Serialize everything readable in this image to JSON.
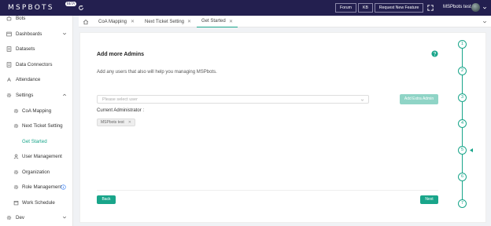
{
  "header": {
    "logo": "MSPBOTS",
    "beta": "BETA",
    "links": [
      "Forum",
      "KB",
      "Request New Feature"
    ],
    "user_name": "MSPbots test"
  },
  "sidebar": {
    "items": [
      {
        "label": "Bots",
        "icon": "bot-icon",
        "top": 0
      },
      {
        "label": "Dashboards",
        "icon": "dashboard-icon",
        "arrow": "down"
      },
      {
        "label": "Datasets",
        "icon": "dataset-icon"
      },
      {
        "label": "Data Connectors",
        "icon": "connector-icon"
      },
      {
        "label": "Attendance",
        "icon": "attendance-icon"
      },
      {
        "label": "Settings",
        "icon": "gear-icon",
        "arrow": "up"
      },
      {
        "label": "CoA Mapping",
        "icon": "gear-icon",
        "sub": true
      },
      {
        "label": "Next Ticket Setting",
        "icon": "gear-icon",
        "sub": true
      },
      {
        "label": "Get Started",
        "sub": true,
        "active": true
      },
      {
        "label": "User Management",
        "icon": "user-icon",
        "sub": true
      },
      {
        "label": "Organization",
        "icon": "gear-icon",
        "sub": true
      },
      {
        "label": "Role Management",
        "icon": "gear-icon",
        "sub": true,
        "info": true
      },
      {
        "label": "Work Schedule",
        "icon": "calendar-icon",
        "sub": true
      },
      {
        "label": "Dev",
        "icon": "gear-icon",
        "arrow": "down"
      }
    ]
  },
  "tabs": [
    {
      "label": "CoA Mapping"
    },
    {
      "label": "Next Ticket Setting"
    },
    {
      "label": "Get Started",
      "active": true
    }
  ],
  "main": {
    "title": "Add more Admins",
    "description": "Add any users that also will help you managing MSPbots.",
    "select_placeholder": "Please select user",
    "add_button": "Add Extra Admin",
    "current_label": "Current Administrator :",
    "admin_tag": "MSPbots test",
    "back_button": "Back",
    "next_button": "Next"
  },
  "stepper": {
    "steps": [
      "1",
      "2",
      "3",
      "4",
      "5",
      "6",
      "7"
    ],
    "current": 5
  },
  "colors": {
    "accent": "#19a58a",
    "header": "#231f4f"
  }
}
